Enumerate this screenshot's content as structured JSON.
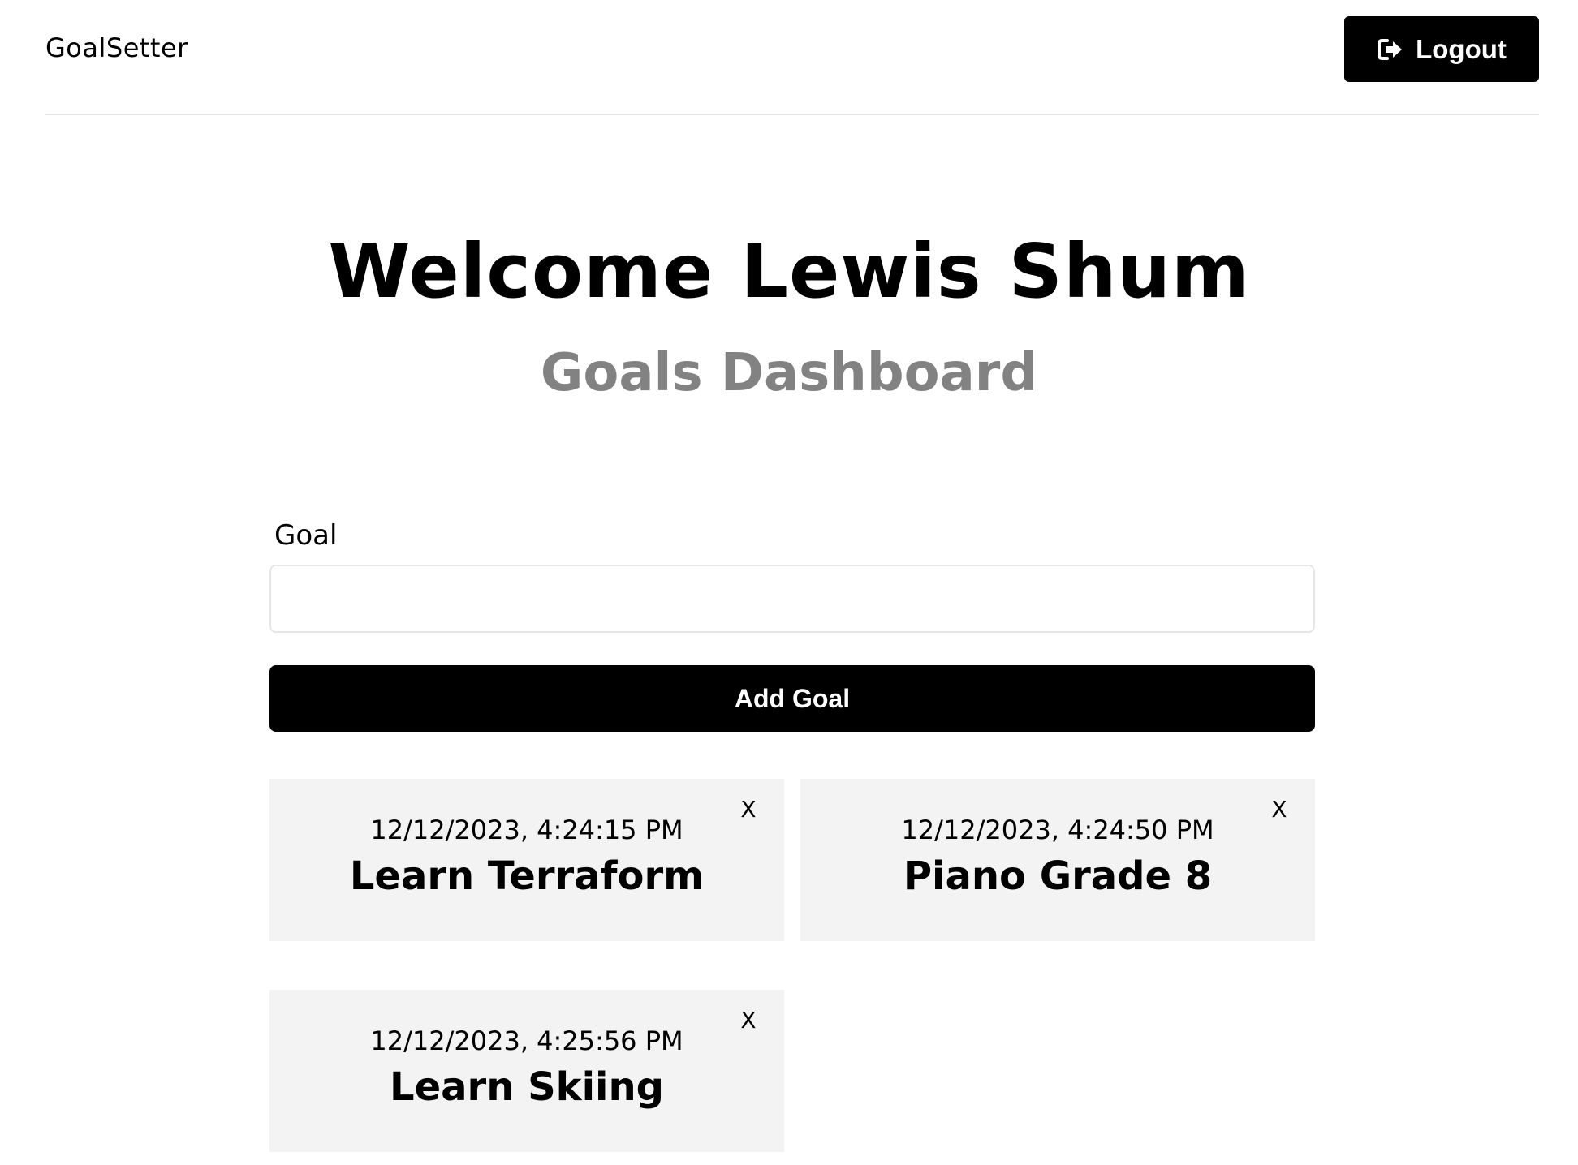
{
  "header": {
    "brand": "GoalSetter",
    "logout_label": "Logout",
    "logout_icon": "sign-out-icon"
  },
  "main": {
    "title": "Welcome Lewis Shum",
    "subtitle": "Goals Dashboard"
  },
  "form": {
    "goal_label": "Goal",
    "goal_value": "",
    "goal_placeholder": "",
    "add_label": "Add Goal"
  },
  "goals": [
    {
      "date": "12/12/2023, 4:24:15 PM",
      "text": "Learn Terraform",
      "close_label": "X"
    },
    {
      "date": "12/12/2023, 4:24:50 PM",
      "text": "Piano Grade 8",
      "close_label": "X"
    },
    {
      "date": "12/12/2023, 4:25:56 PM",
      "text": "Learn Skiing",
      "close_label": "X"
    }
  ],
  "colors": {
    "primary": "#000000",
    "subtitle": "#828282",
    "card_bg": "#f3f3f3",
    "divider": "#e6e6e6"
  }
}
